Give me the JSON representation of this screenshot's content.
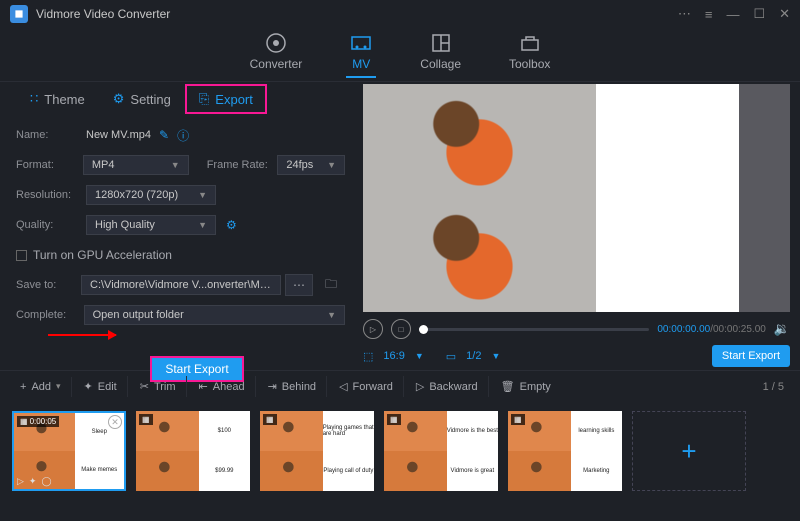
{
  "app_title": "Vidmore Video Converter",
  "topnav": {
    "converter": "Converter",
    "mv": "MV",
    "collage": "Collage",
    "toolbox": "Toolbox"
  },
  "tabs": {
    "theme": "Theme",
    "setting": "Setting",
    "export": "Export"
  },
  "form": {
    "name_lbl": "Name:",
    "name_val": "New MV.mp4",
    "format_lbl": "Format:",
    "format_val": "MP4",
    "framerate_lbl": "Frame Rate:",
    "framerate_val": "24fps",
    "resolution_lbl": "Resolution:",
    "resolution_val": "1280x720 (720p)",
    "quality_lbl": "Quality:",
    "quality_val": "High Quality",
    "gpu_lbl": "Turn on GPU Acceleration",
    "saveto_lbl": "Save to:",
    "saveto_val": "C:\\Vidmore\\Vidmore V...onverter\\MV Exported",
    "complete_lbl": "Complete:",
    "complete_val": "Open output folder",
    "start_export": "Start Export"
  },
  "preview": {
    "time_current": "00:00:00.00",
    "time_total": "00:00:25.00",
    "aspect": "16:9",
    "page": "1/2",
    "start_export": "Start Export"
  },
  "toolbar": {
    "add": "Add",
    "edit": "Edit",
    "trim": "Trim",
    "ahead": "Ahead",
    "behind": "Behind",
    "forward": "Forward",
    "backward": "Backward",
    "empty": "Empty",
    "count": "1 / 5"
  },
  "thumbs": {
    "duration": "0:00:05",
    "tr1": "Sleep",
    "br1": "Make memes",
    "tr2": "$100",
    "br2": "$99.99",
    "tr3": "Playing games that are hard",
    "br3": "Playing call of duty",
    "tr4": "Vidmore is the best",
    "br4": "Vidmore is great",
    "tr5": "learning skills",
    "br5": "Marketing"
  }
}
